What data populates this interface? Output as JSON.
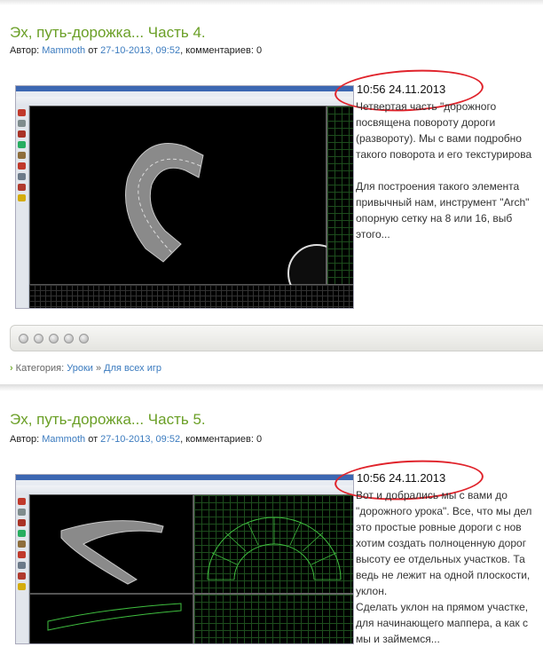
{
  "posts": [
    {
      "title": "Эх, путь-дорожка... Часть 4.",
      "meta": {
        "author_label": "Автор:",
        "author": "Mammoth",
        "from_label": "от",
        "date": "27-10-2013, 09:52",
        "comments": ", комментариев: 0"
      },
      "timestamp": "10:56 24.11.2013",
      "excerpt": [
        "Четвертая  часть  \"дорожного",
        "посвящена  повороту  дороги",
        "(развороту). Мы с вами подробно",
        "такого поворота и его текстурирова",
        "",
        "Для построения такого элемента",
        "привычный нам, инструмент \"Arch\"",
        "опорную сетку на 8 или 16, выб",
        "этого..."
      ]
    },
    {
      "title": "Эх, путь-дорожка... Часть 5.",
      "meta": {
        "author_label": "Автор:",
        "author": "Mammoth",
        "from_label": "от",
        "date": "27-10-2013, 09:52",
        "comments": ", комментариев: 0"
      },
      "timestamp": "10:56 24.11.2013",
      "excerpt": [
        "Вот  и  добрались  мы  с  вами  до",
        "\"дорожного урока\". Все, что мы дел",
        "это простые ровные дороги с нов",
        "хотим создать полноценную дорог",
        "высоту ее отдельных участков. Та",
        "ведь не лежит на одной плоскости,",
        "уклон.",
        "Сделать уклон на прямом участке,",
        "для начинающего маппера, а как с",
        "мы и займемся..."
      ]
    }
  ],
  "category": {
    "label": "Категория:",
    "link1": "Уроки",
    "separator": "»",
    "link2": "Для всех игр"
  },
  "share_dots": 5,
  "colors": {
    "title_green": "#6a9f26",
    "link_blue": "#3b7bbf",
    "annotation_red": "#e0232b"
  }
}
